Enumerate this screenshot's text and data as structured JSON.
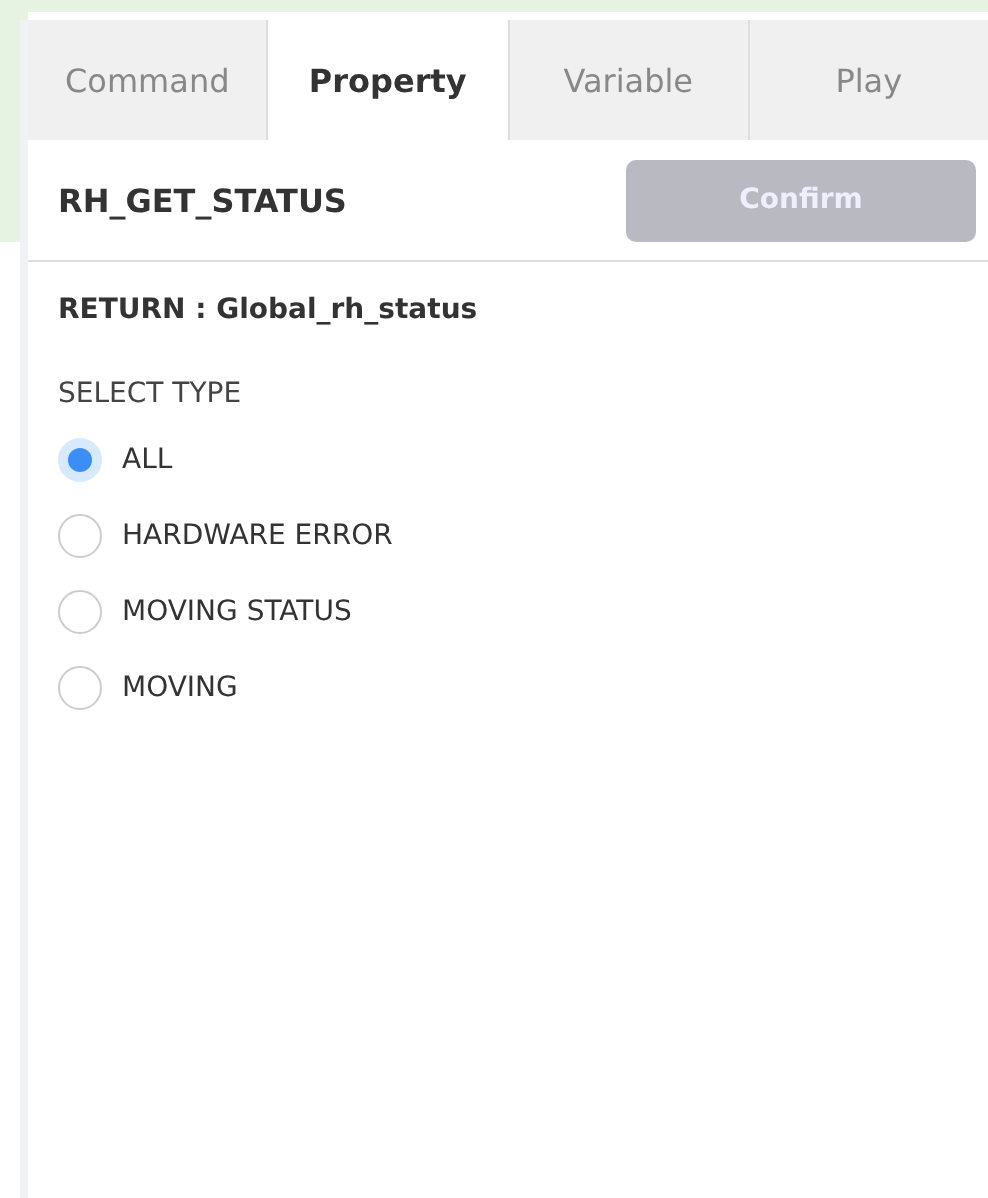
{
  "tabs": [
    {
      "label": "Command",
      "selected": false
    },
    {
      "label": "Property",
      "selected": true
    },
    {
      "label": "Variable",
      "selected": false
    },
    {
      "label": "Play",
      "selected": false
    }
  ],
  "header": {
    "title": "RH_GET_STATUS",
    "confirm_button": {
      "label": "Confirm",
      "disabled": true
    }
  },
  "return_label": "RETURN : Global_rh_status",
  "select_type": {
    "label": "SELECT TYPE",
    "options": [
      {
        "label": "ALL",
        "selected": true
      },
      {
        "label": "HARDWARE ERROR",
        "selected": false
      },
      {
        "label": "MOVING STATUS",
        "selected": false
      },
      {
        "label": "MOVING",
        "selected": false
      }
    ]
  }
}
